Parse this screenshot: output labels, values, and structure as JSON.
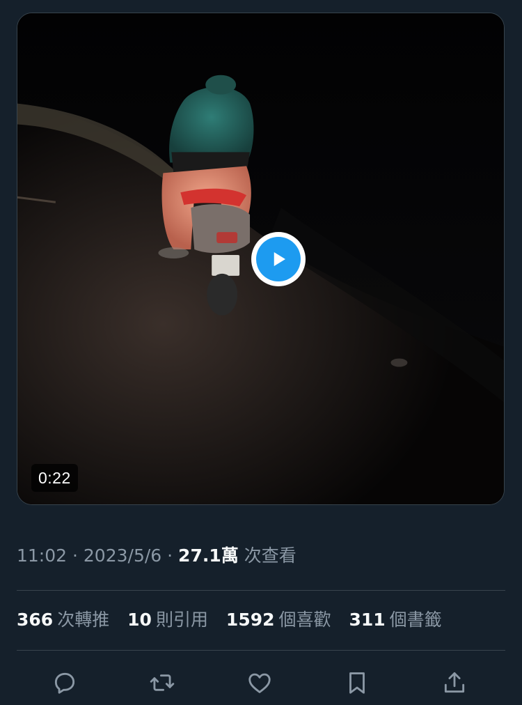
{
  "video": {
    "duration": "0:22"
  },
  "meta": {
    "time": "11:02",
    "separator": "·",
    "date": "2023/5/6",
    "views": "27.1萬",
    "views_label": "次查看"
  },
  "stats": [
    {
      "value": "366",
      "label": "次轉推"
    },
    {
      "value": "10",
      "label": "則引用"
    },
    {
      "value": "1592",
      "label": "個喜歡"
    },
    {
      "value": "311",
      "label": "個書籤"
    }
  ],
  "actions": [
    "reply-icon",
    "retweet-icon",
    "like-icon",
    "bookmark-icon",
    "share-icon"
  ],
  "colors": {
    "background": "#15202b",
    "accent": "#1d9bf0",
    "text_primary": "#f7f9f9",
    "text_secondary": "#8b98a5",
    "border": "#38444d"
  }
}
